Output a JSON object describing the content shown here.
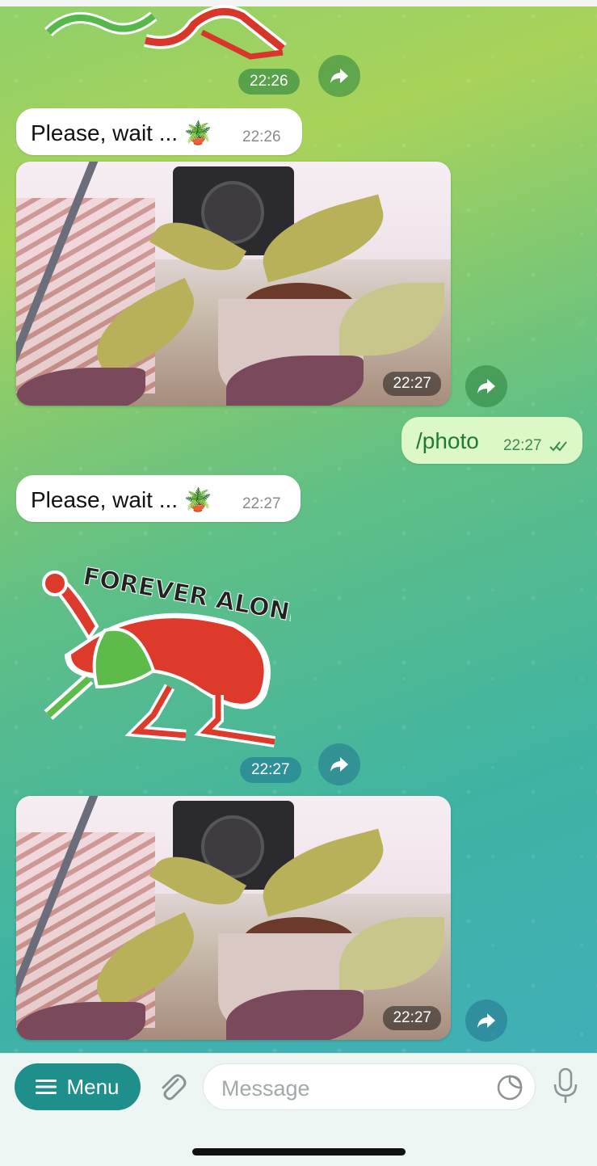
{
  "messages": [
    {
      "type": "sticker_time",
      "time": "22:26"
    },
    {
      "type": "incoming_text",
      "text": "Please, wait ...",
      "emoji": "🪴",
      "time": "22:26"
    },
    {
      "type": "incoming_photo",
      "time": "22:27"
    },
    {
      "type": "outgoing_text",
      "text": "/photo",
      "time": "22:27",
      "status": "read-double-check"
    },
    {
      "type": "incoming_text",
      "text": "Please, wait ...",
      "emoji": "🪴",
      "time": "22:27"
    },
    {
      "type": "sticker",
      "caption": "FOREVER ALONE",
      "time": "22:27"
    },
    {
      "type": "incoming_photo",
      "time": "22:27"
    }
  ],
  "composer": {
    "menu_label": "Menu",
    "placeholder": "Message"
  },
  "icons": [
    "forward-icon",
    "hamburger-icon",
    "paperclip-icon",
    "sticker-icon",
    "microphone-icon",
    "double-check-icon"
  ],
  "colors": {
    "menu_button": "#1e8f8a",
    "outgoing_bubble": "#dcf8c6",
    "incoming_bubble": "#ffffff"
  }
}
